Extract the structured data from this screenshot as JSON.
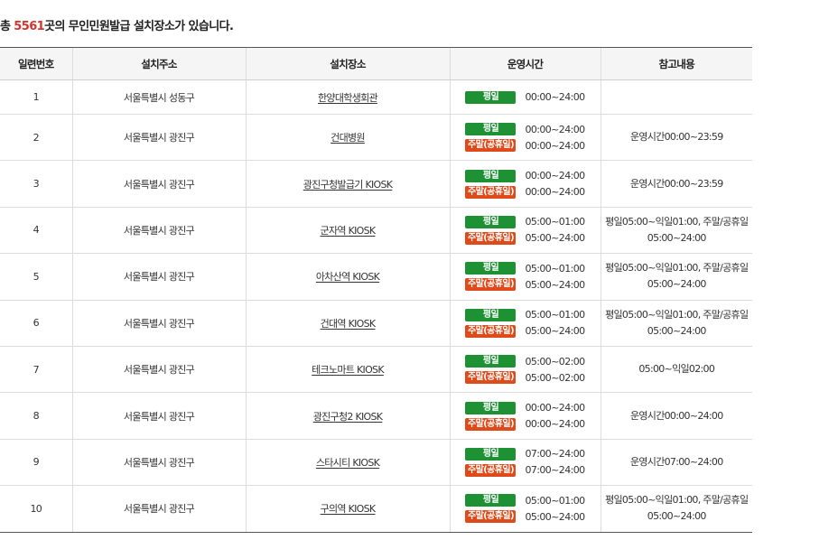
{
  "summary": {
    "prefix": "총 ",
    "count": "5561",
    "suffix": "곳의 무인민원발급 설치장소가 있습니다."
  },
  "badges": {
    "weekday": "평일",
    "weekend": "주말(공휴일)"
  },
  "colors": {
    "weekday_badge": "#1e9135",
    "weekend_badge": "#de4a1a",
    "count_highlight": "#d0342c"
  },
  "table": {
    "headers": [
      "일련번호",
      "설치주소",
      "설치장소",
      "운영시간",
      "참고내용"
    ],
    "rows": [
      {
        "no": "1",
        "address": "서울특별시 성동구",
        "place": "한양대학생회관",
        "weekday": "00:00~24:00",
        "weekend": "",
        "note": ""
      },
      {
        "no": "2",
        "address": "서울특별시 광진구",
        "place": "건대병원",
        "weekday": "00:00~24:00",
        "weekend": "00:00~24:00",
        "note": "운영시간00:00~23:59"
      },
      {
        "no": "3",
        "address": "서울특별시 광진구",
        "place": "광진구청발급기 KIOSK",
        "weekday": "00:00~24:00",
        "weekend": "00:00~24:00",
        "note": "운영시간00:00~23:59"
      },
      {
        "no": "4",
        "address": "서울특별시 광진구",
        "place": "군자역 KIOSK",
        "weekday": "05:00~01:00",
        "weekend": "05:00~24:00",
        "note": "평일05:00~익일01:00, 주말/공휴일 05:00~24:00"
      },
      {
        "no": "5",
        "address": "서울특별시 광진구",
        "place": "아차산역 KIOSK",
        "weekday": "05:00~01:00",
        "weekend": "05:00~24:00",
        "note": "평일05:00~익일01:00, 주말/공휴일 05:00~24:00"
      },
      {
        "no": "6",
        "address": "서울특별시 광진구",
        "place": "건대역 KIOSK",
        "weekday": "05:00~01:00",
        "weekend": "05:00~24:00",
        "note": "평일05:00~익일01:00, 주말/공휴일 05:00~24:00"
      },
      {
        "no": "7",
        "address": "서울특별시 광진구",
        "place": "테크노마트 KIOSK",
        "weekday": "05:00~02:00",
        "weekend": "05:00~02:00",
        "note": "05:00~익일02:00"
      },
      {
        "no": "8",
        "address": "서울특별시 광진구",
        "place": "광진구청2 KIOSK",
        "weekday": "00:00~24:00",
        "weekend": "00:00~24:00",
        "note": "운영시간00:00~24:00"
      },
      {
        "no": "9",
        "address": "서울특별시 광진구",
        "place": "스타시티 KIOSK",
        "weekday": "07:00~24:00",
        "weekend": "07:00~24:00",
        "note": "운영시간07:00~24:00"
      },
      {
        "no": "10",
        "address": "서울특별시 광진구",
        "place": "구의역 KIOSK",
        "weekday": "05:00~01:00",
        "weekend": "05:00~24:00",
        "note": "평일05:00~익일01:00, 주말/공휴일 05:00~24:00"
      }
    ]
  }
}
